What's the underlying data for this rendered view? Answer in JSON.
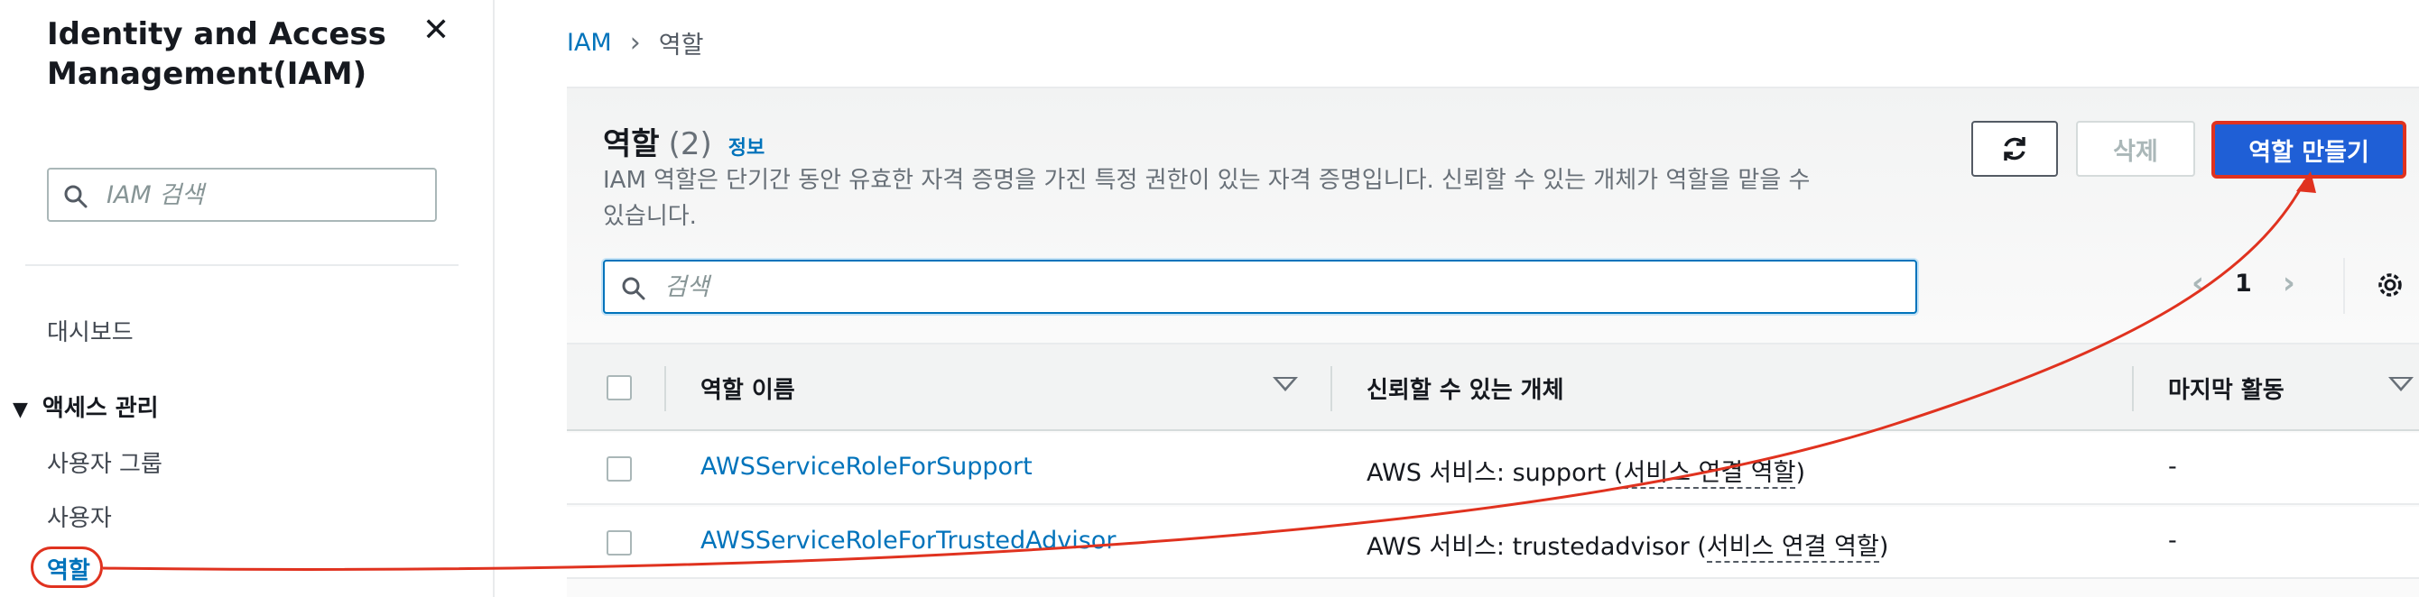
{
  "sidebar": {
    "title": "Identity and Access Management(IAM)",
    "search_placeholder": "IAM 검색",
    "dashboard": "대시보드",
    "section_access": "액세스 관리",
    "user_groups": "사용자 그룹",
    "users": "사용자",
    "roles": "역할"
  },
  "breadcrumb": {
    "root": "IAM",
    "current": "역할"
  },
  "header": {
    "title": "역할",
    "count": "(2)",
    "info": "정보",
    "description": "IAM 역할은 단기간 동안 유효한 자격 증명을 가진 특정 권한이 있는 자격 증명입니다. 신뢰할 수 있는 개체가 역할을 맡을 수 있습니다."
  },
  "actions": {
    "delete_label": "삭제",
    "create_label": "역할 만들기"
  },
  "search": {
    "placeholder": "검색"
  },
  "pagination": {
    "current_page": "1"
  },
  "table": {
    "columns": [
      "역할 이름",
      "신뢰할 수 있는 개체",
      "마지막 활동"
    ],
    "rows": [
      {
        "role_name": "AWSServiceRoleForSupport",
        "trusted_prefix": "AWS 서비스: support (",
        "trusted_link": "서비스 연결 역할",
        "trusted_suffix": ")",
        "last_activity": "-"
      },
      {
        "role_name": "AWSServiceRoleForTrustedAdvisor",
        "trusted_prefix": "AWS 서비스: trustedadvisor (",
        "trusted_link": "서비스 연결 역할",
        "trusted_suffix": ")",
        "last_activity": "-"
      }
    ]
  },
  "colors": {
    "link": "#0073bb",
    "annotation": "#e0321f",
    "primary_button": "#1f5fd6"
  }
}
